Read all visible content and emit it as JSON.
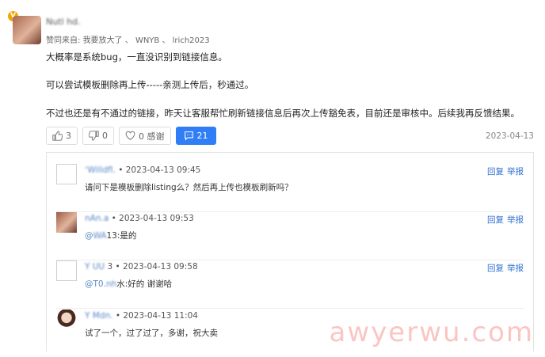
{
  "post": {
    "username": "Nutl hd.",
    "praise_prefix": "赞同来自:",
    "praise_names": [
      "我要放大了",
      "WNYB",
      "lrich2023"
    ],
    "praise_sep": "、",
    "lines": [
      "大概率是系统bug，一直没识别到链接信息。",
      "可以尝试模板删除再上传-----亲测上传后，秒通过。",
      "不过也还是有不通过的链接，昨天让客服帮忙刷新链接信息后再次上传豁免表，目前还是审核中。后续我再反馈结果。"
    ],
    "actions": {
      "like_count": "3",
      "dislike_count": "0",
      "thanks_label": "0 感谢",
      "comment_count": "21"
    },
    "date": "2023-04-13"
  },
  "replies": [
    {
      "name": "ʻWilldfl.",
      "meta": "• 2023-04-13 09:45",
      "mention_at": "",
      "mention_name": "",
      "text": "请问下是模板删除listing么？然后再上传也模板刷新吗？",
      "avatar": "blank"
    },
    {
      "name": "nAn.a",
      "meta": "• 2023-04-13 09:53",
      "mention_at": "@",
      "mention_name": "WA",
      "text": "13:是的",
      "avatar": "photo1"
    },
    {
      "name": "Y UU",
      "meta": "3 • 2023-04-13 09:58",
      "mention_at": "@T0.",
      "mention_name": "nh",
      "text": "水:好的 谢谢哈",
      "avatar": "blank"
    },
    {
      "name": "Y Mdn.",
      "meta": "• 2023-04-13 11:04",
      "mention_at": "",
      "mention_name": "",
      "text": "试了一个，过了过了，多谢，祝大卖",
      "avatar": "photo2"
    }
  ],
  "reply_links": {
    "reply": "回复",
    "report": "举报"
  },
  "watermark": "awyerwu.com"
}
